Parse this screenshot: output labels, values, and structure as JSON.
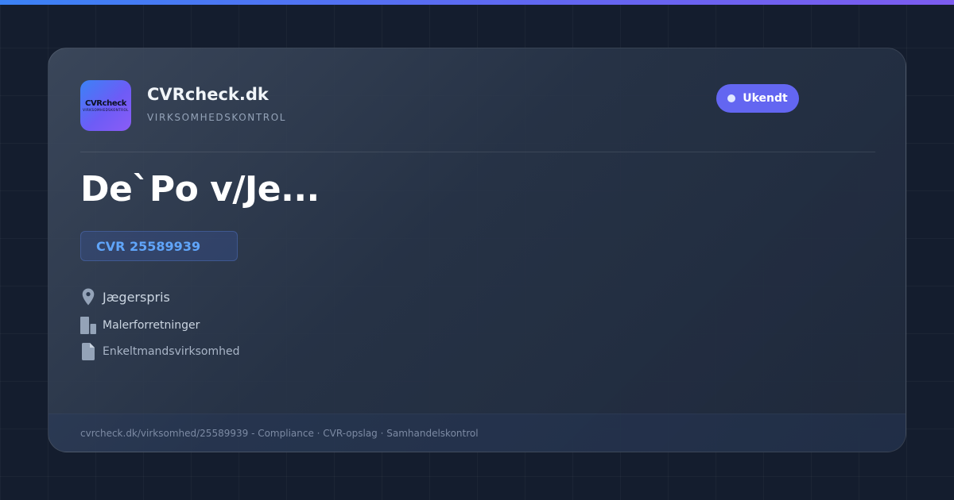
{
  "brand": {
    "logo_text": "CVRcheck",
    "logo_subtext": "VIRKSOMHEDSKONTROL",
    "name": "CVRcheck.dk",
    "tagline": "VIRKSOMHEDSKONTROL",
    "accent": "#6366f1"
  },
  "status": {
    "label": "Ukendt",
    "color": "#6366f1"
  },
  "company": {
    "name": "De`Po v/Je...",
    "cvr": "CVR 25589939",
    "city": "Jægerspris",
    "industry": "Malerforretninger",
    "company_type": "Enkeltmandsvirksomhed"
  },
  "icons": {
    "city": "location-pin-icon",
    "industry": "building-icon",
    "company_type": "document-icon"
  },
  "footer": {
    "text": "cvrcheck.dk/virksomhed/25589939 - Compliance · CVR-opslag · Samhandelskontrol"
  }
}
